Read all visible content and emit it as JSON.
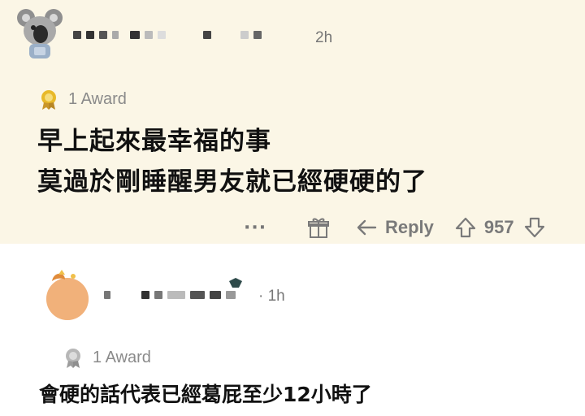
{
  "post": {
    "time": "2h",
    "award_label": "1 Award",
    "lines": [
      "早上起來最幸福的事",
      "莫過於剛睡醒男友就已經硬硬的了"
    ],
    "actions": {
      "more": "···",
      "reply_label": "Reply",
      "vote_count": "957"
    }
  },
  "reply": {
    "time": "· 1h",
    "award_label": "1 Award",
    "text": "會硬的話代表已經葛屁至少12小時了"
  },
  "icons": {
    "award": "award-icon",
    "gift": "gift-icon",
    "reply": "reply-arrow-icon",
    "upvote": "upvote-icon",
    "downvote": "downvote-icon",
    "more": "more-options-icon"
  },
  "colors": {
    "post_background": "#fbf6e6",
    "text": "#111111",
    "muted": "#7a7a7a",
    "award_gold": "#d9a520"
  }
}
